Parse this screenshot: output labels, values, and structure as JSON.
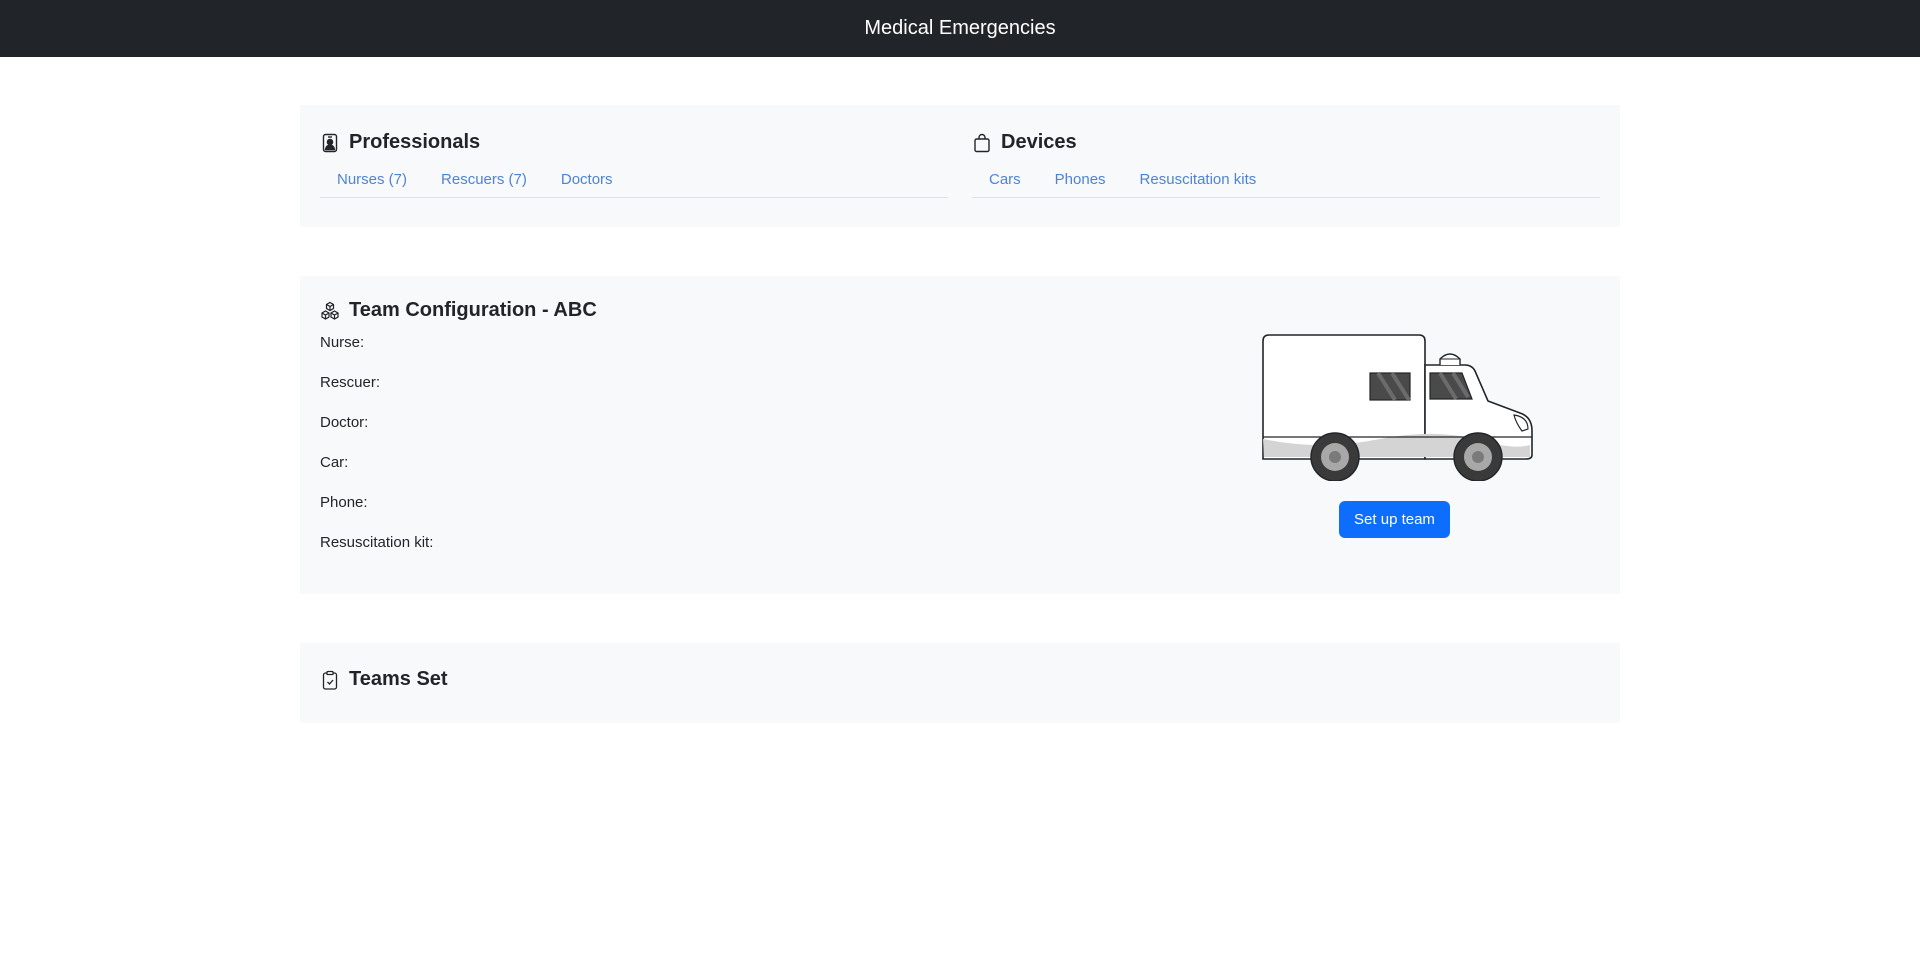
{
  "navbar": {
    "title": "Medical Emergencies"
  },
  "professionals": {
    "title": "Professionals",
    "icon": "person-badge-icon",
    "tabs": [
      "Nurses (7)",
      "Rescuers (7)",
      "Doctors"
    ]
  },
  "devices": {
    "title": "Devices",
    "icon": "bag-icon",
    "tabs": [
      "Cars",
      "Phones",
      "Resuscitation kits"
    ]
  },
  "config": {
    "title": "Team Configuration - ABC",
    "icon": "boxes-icon",
    "fields": {
      "nurse": "Nurse:",
      "rescuer": "Rescuer:",
      "doctor": "Doctor:",
      "car": "Car:",
      "phone": "Phone:",
      "kit": "Resuscitation kit:"
    },
    "button": "Set up team",
    "illustration": "ambulance-illustration"
  },
  "teams": {
    "title": "Teams Set",
    "icon": "clipboard-check-icon"
  },
  "colors": {
    "navbar": "#212529",
    "card": "#f8f9fa",
    "primary": "#0d6efd",
    "link": "#2f6fd2"
  }
}
